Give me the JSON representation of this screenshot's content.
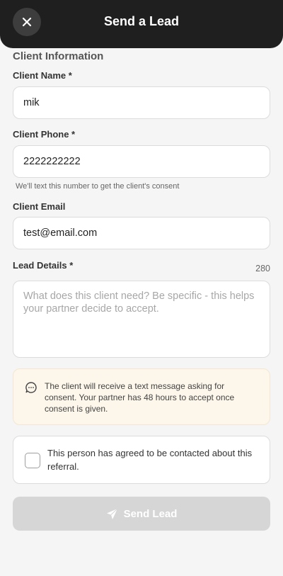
{
  "header": {
    "title": "Send a Lead",
    "close_icon": "close-icon"
  },
  "form": {
    "section_title": "Client Information",
    "client_name": {
      "label": "Client Name *",
      "value": "mik"
    },
    "client_phone": {
      "label": "Client Phone *",
      "value": "2222222222",
      "hint": "We'll text this number to get the client's consent"
    },
    "client_email": {
      "label": "Client Email",
      "value": "test@email.com"
    },
    "lead_details": {
      "label": "Lead Details *",
      "counter": "280",
      "placeholder": "What does this client need? Be specific - this helps your partner decide to accept.",
      "value": ""
    }
  },
  "notice": {
    "icon": "chat-bubble-icon",
    "text": "The client will receive a text message asking for consent. Your partner has 48 hours to accept once consent is given."
  },
  "consent": {
    "checked": false,
    "text": "This person has agreed to be contacted about this referral."
  },
  "send_button": {
    "label": "Send Lead",
    "icon": "paper-plane-icon",
    "disabled": true
  },
  "colors": {
    "header_bg": "#1f1f1f",
    "page_bg": "#f5f5f5",
    "notice_bg": "#fdf6ea",
    "button_disabled_bg": "#d6d6d6"
  }
}
